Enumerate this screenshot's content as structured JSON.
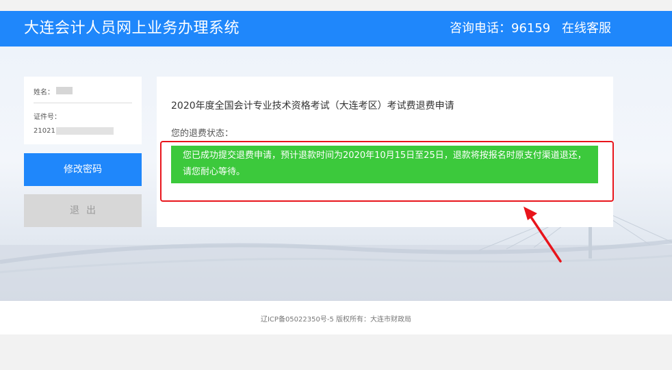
{
  "header": {
    "title": "大连会计人员网上业务办理系统",
    "hotline": "咨询电话：96159",
    "service": "在线客服"
  },
  "user": {
    "name_label": "姓名：",
    "id_label": "证件号：",
    "id_prefix": "21021"
  },
  "buttons": {
    "change_password": "修改密码",
    "logout": "退出"
  },
  "main": {
    "exam_title": "2020年度全国会计专业技术资格考试（大连考区）考试费退费申请",
    "status_label": "您的退费状态：",
    "status_message": "您已成功提交退费申请，预计退款时间为2020年10月15日至25日，退款将按报名时原支付渠道退还，请您耐心等待。"
  },
  "footer": {
    "text": "辽ICP备05022350号-5  版权所有：大连市财政局"
  },
  "colors": {
    "brand_blue": "#1f87fb",
    "success_green": "#3cc93c",
    "annotation_red": "#e8141b"
  }
}
